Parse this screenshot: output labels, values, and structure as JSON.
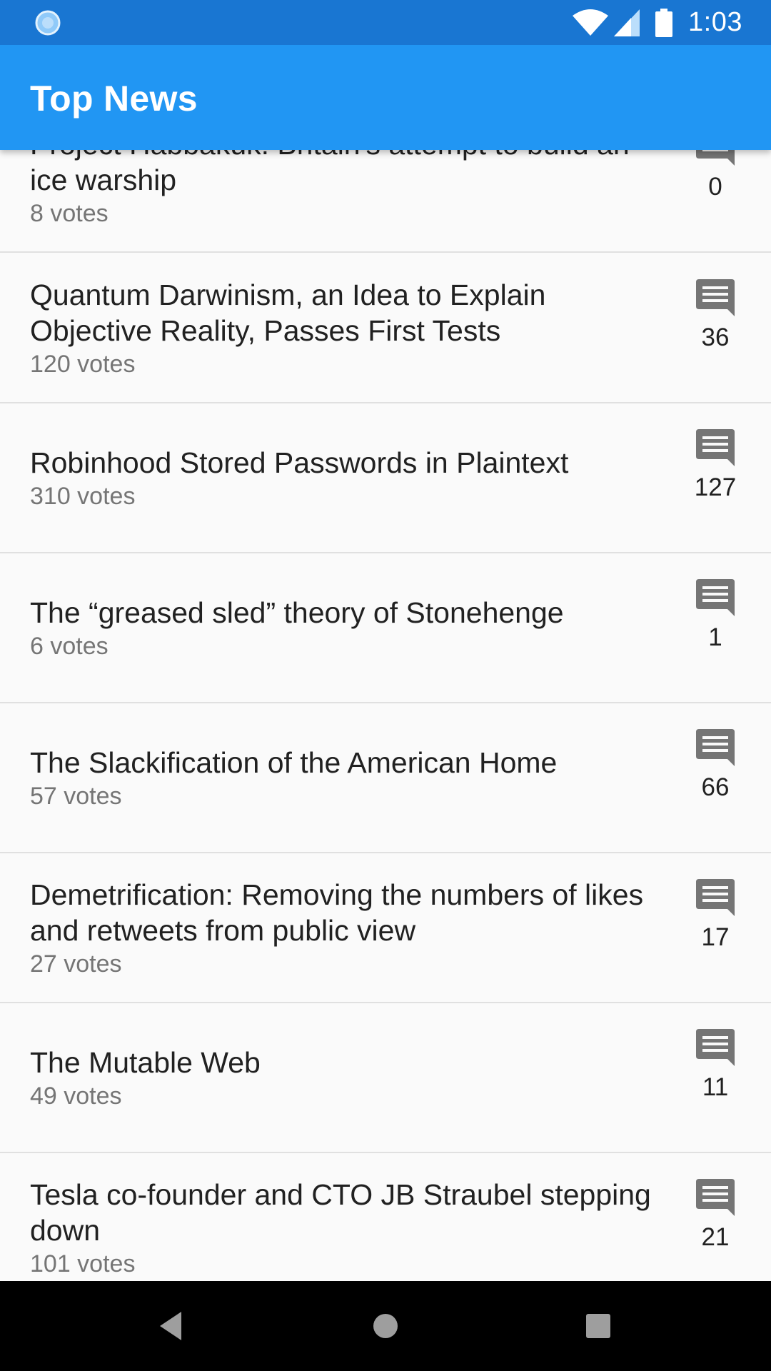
{
  "status_bar": {
    "time": "1:03"
  },
  "app_bar": {
    "title": "Top News"
  },
  "stories": [
    {
      "title": "Project Habbakuk: Britain's attempt to build an ice warship",
      "votes": "8 votes",
      "comments": "0"
    },
    {
      "title": "Quantum Darwinism, an Idea to Explain Objective Reality, Passes First Tests",
      "votes": "120 votes",
      "comments": "36"
    },
    {
      "title": "Robinhood Stored Passwords in Plaintext",
      "votes": "310 votes",
      "comments": "127"
    },
    {
      "title": "The “greased sled” theory of Stonehenge",
      "votes": "6 votes",
      "comments": "1"
    },
    {
      "title": "The Slackification of the American Home",
      "votes": "57 votes",
      "comments": "66"
    },
    {
      "title": "Demetrification: Removing the numbers of likes and retweets from public view",
      "votes": "27 votes",
      "comments": "17"
    },
    {
      "title": "The Mutable Web",
      "votes": "49 votes",
      "comments": "11"
    },
    {
      "title": "Tesla co-founder and CTO JB Straubel stepping down",
      "votes": "101 votes",
      "comments": "21"
    }
  ],
  "icons": {
    "comment": "comment-icon",
    "nav": [
      "back-icon",
      "home-icon",
      "recents-icon"
    ]
  },
  "colors": {
    "status_bar": "#1976d2",
    "app_bar": "#2196f3",
    "background": "#fafafa",
    "divider": "#e0e0e0"
  }
}
